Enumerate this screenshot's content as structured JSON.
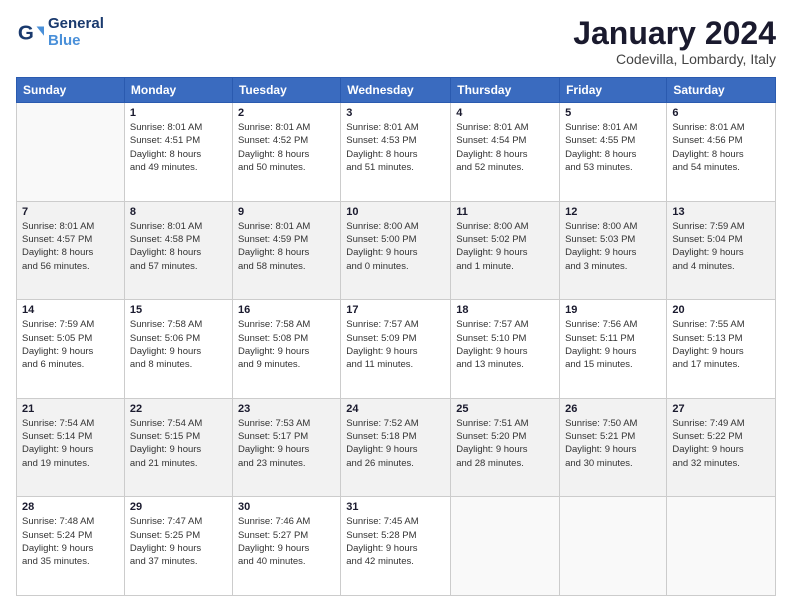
{
  "logo": {
    "line1": "General",
    "line2": "Blue"
  },
  "header": {
    "month": "January 2024",
    "location": "Codevilla, Lombardy, Italy"
  },
  "days_of_week": [
    "Sunday",
    "Monday",
    "Tuesday",
    "Wednesday",
    "Thursday",
    "Friday",
    "Saturday"
  ],
  "weeks": [
    [
      {
        "day": "",
        "info": ""
      },
      {
        "day": "1",
        "info": "Sunrise: 8:01 AM\nSunset: 4:51 PM\nDaylight: 8 hours\nand 49 minutes."
      },
      {
        "day": "2",
        "info": "Sunrise: 8:01 AM\nSunset: 4:52 PM\nDaylight: 8 hours\nand 50 minutes."
      },
      {
        "day": "3",
        "info": "Sunrise: 8:01 AM\nSunset: 4:53 PM\nDaylight: 8 hours\nand 51 minutes."
      },
      {
        "day": "4",
        "info": "Sunrise: 8:01 AM\nSunset: 4:54 PM\nDaylight: 8 hours\nand 52 minutes."
      },
      {
        "day": "5",
        "info": "Sunrise: 8:01 AM\nSunset: 4:55 PM\nDaylight: 8 hours\nand 53 minutes."
      },
      {
        "day": "6",
        "info": "Sunrise: 8:01 AM\nSunset: 4:56 PM\nDaylight: 8 hours\nand 54 minutes."
      }
    ],
    [
      {
        "day": "7",
        "info": "Sunrise: 8:01 AM\nSunset: 4:57 PM\nDaylight: 8 hours\nand 56 minutes."
      },
      {
        "day": "8",
        "info": "Sunrise: 8:01 AM\nSunset: 4:58 PM\nDaylight: 8 hours\nand 57 minutes."
      },
      {
        "day": "9",
        "info": "Sunrise: 8:01 AM\nSunset: 4:59 PM\nDaylight: 8 hours\nand 58 minutes."
      },
      {
        "day": "10",
        "info": "Sunrise: 8:00 AM\nSunset: 5:00 PM\nDaylight: 9 hours\nand 0 minutes."
      },
      {
        "day": "11",
        "info": "Sunrise: 8:00 AM\nSunset: 5:02 PM\nDaylight: 9 hours\nand 1 minute."
      },
      {
        "day": "12",
        "info": "Sunrise: 8:00 AM\nSunset: 5:03 PM\nDaylight: 9 hours\nand 3 minutes."
      },
      {
        "day": "13",
        "info": "Sunrise: 7:59 AM\nSunset: 5:04 PM\nDaylight: 9 hours\nand 4 minutes."
      }
    ],
    [
      {
        "day": "14",
        "info": "Sunrise: 7:59 AM\nSunset: 5:05 PM\nDaylight: 9 hours\nand 6 minutes."
      },
      {
        "day": "15",
        "info": "Sunrise: 7:58 AM\nSunset: 5:06 PM\nDaylight: 9 hours\nand 8 minutes."
      },
      {
        "day": "16",
        "info": "Sunrise: 7:58 AM\nSunset: 5:08 PM\nDaylight: 9 hours\nand 9 minutes."
      },
      {
        "day": "17",
        "info": "Sunrise: 7:57 AM\nSunset: 5:09 PM\nDaylight: 9 hours\nand 11 minutes."
      },
      {
        "day": "18",
        "info": "Sunrise: 7:57 AM\nSunset: 5:10 PM\nDaylight: 9 hours\nand 13 minutes."
      },
      {
        "day": "19",
        "info": "Sunrise: 7:56 AM\nSunset: 5:11 PM\nDaylight: 9 hours\nand 15 minutes."
      },
      {
        "day": "20",
        "info": "Sunrise: 7:55 AM\nSunset: 5:13 PM\nDaylight: 9 hours\nand 17 minutes."
      }
    ],
    [
      {
        "day": "21",
        "info": "Sunrise: 7:54 AM\nSunset: 5:14 PM\nDaylight: 9 hours\nand 19 minutes."
      },
      {
        "day": "22",
        "info": "Sunrise: 7:54 AM\nSunset: 5:15 PM\nDaylight: 9 hours\nand 21 minutes."
      },
      {
        "day": "23",
        "info": "Sunrise: 7:53 AM\nSunset: 5:17 PM\nDaylight: 9 hours\nand 23 minutes."
      },
      {
        "day": "24",
        "info": "Sunrise: 7:52 AM\nSunset: 5:18 PM\nDaylight: 9 hours\nand 26 minutes."
      },
      {
        "day": "25",
        "info": "Sunrise: 7:51 AM\nSunset: 5:20 PM\nDaylight: 9 hours\nand 28 minutes."
      },
      {
        "day": "26",
        "info": "Sunrise: 7:50 AM\nSunset: 5:21 PM\nDaylight: 9 hours\nand 30 minutes."
      },
      {
        "day": "27",
        "info": "Sunrise: 7:49 AM\nSunset: 5:22 PM\nDaylight: 9 hours\nand 32 minutes."
      }
    ],
    [
      {
        "day": "28",
        "info": "Sunrise: 7:48 AM\nSunset: 5:24 PM\nDaylight: 9 hours\nand 35 minutes."
      },
      {
        "day": "29",
        "info": "Sunrise: 7:47 AM\nSunset: 5:25 PM\nDaylight: 9 hours\nand 37 minutes."
      },
      {
        "day": "30",
        "info": "Sunrise: 7:46 AM\nSunset: 5:27 PM\nDaylight: 9 hours\nand 40 minutes."
      },
      {
        "day": "31",
        "info": "Sunrise: 7:45 AM\nSunset: 5:28 PM\nDaylight: 9 hours\nand 42 minutes."
      },
      {
        "day": "",
        "info": ""
      },
      {
        "day": "",
        "info": ""
      },
      {
        "day": "",
        "info": ""
      }
    ]
  ]
}
